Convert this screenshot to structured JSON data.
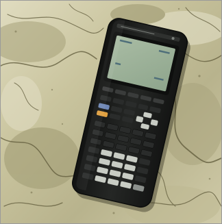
{
  "image": {
    "subject": "graphing-calculator",
    "background": "marble-stone",
    "colors": {
      "stone_light": "#d9d6b8",
      "stone_mid": "#b9b48d",
      "stone_dark": "#7d7a55",
      "vein": "#5f5a3a",
      "calculator_body": "#1c1d1c",
      "screen": "#9eb29a",
      "screen_text": "#4f6f7a",
      "key_dark": "#2a2c2b",
      "key_light": "#c8ccc4",
      "key_blue": "#6e86b4",
      "key_orange": "#e0a040",
      "key_gray": "#8c918d"
    }
  }
}
